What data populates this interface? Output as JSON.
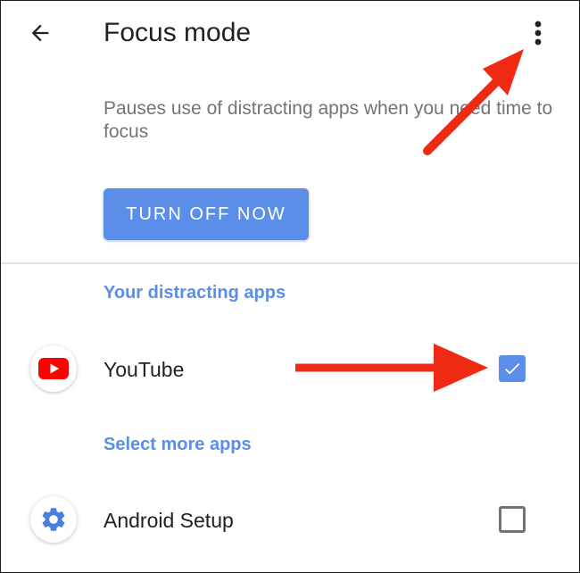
{
  "header": {
    "title": "Focus mode",
    "back_icon": "arrow-left-icon",
    "more_icon": "more-vert-icon"
  },
  "description": "Pauses use of distracting apps when you need time to focus",
  "primary_button": {
    "label": "TURN OFF NOW",
    "color": "#5b8ee8"
  },
  "sections": {
    "distracting": {
      "header": "Your distracting apps",
      "apps": [
        {
          "name": "YouTube",
          "icon": "youtube-icon",
          "checked": true
        }
      ]
    },
    "more": {
      "header": "Select more apps",
      "apps": [
        {
          "name": "Android Setup",
          "icon": "gear-icon",
          "checked": false
        }
      ]
    }
  },
  "colors": {
    "accent": "#5b8ee8",
    "annotation_arrow": "#ee2a12",
    "youtube_red": "#ff0000"
  }
}
